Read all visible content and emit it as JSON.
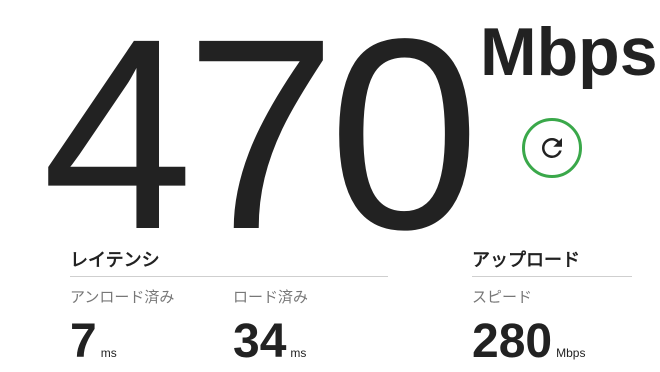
{
  "speed": {
    "value": "470",
    "unit": "Mbps"
  },
  "reload": {
    "icon": "refresh-icon",
    "color": "#3aa84a"
  },
  "latency": {
    "title": "レイテンシ",
    "unloaded": {
      "label": "アンロード済み",
      "value": "7",
      "unit": "ms"
    },
    "loaded": {
      "label": "ロード済み",
      "value": "34",
      "unit": "ms"
    }
  },
  "upload": {
    "title": "アップロード",
    "speed": {
      "label": "スピード",
      "value": "280",
      "unit": "Mbps"
    }
  }
}
